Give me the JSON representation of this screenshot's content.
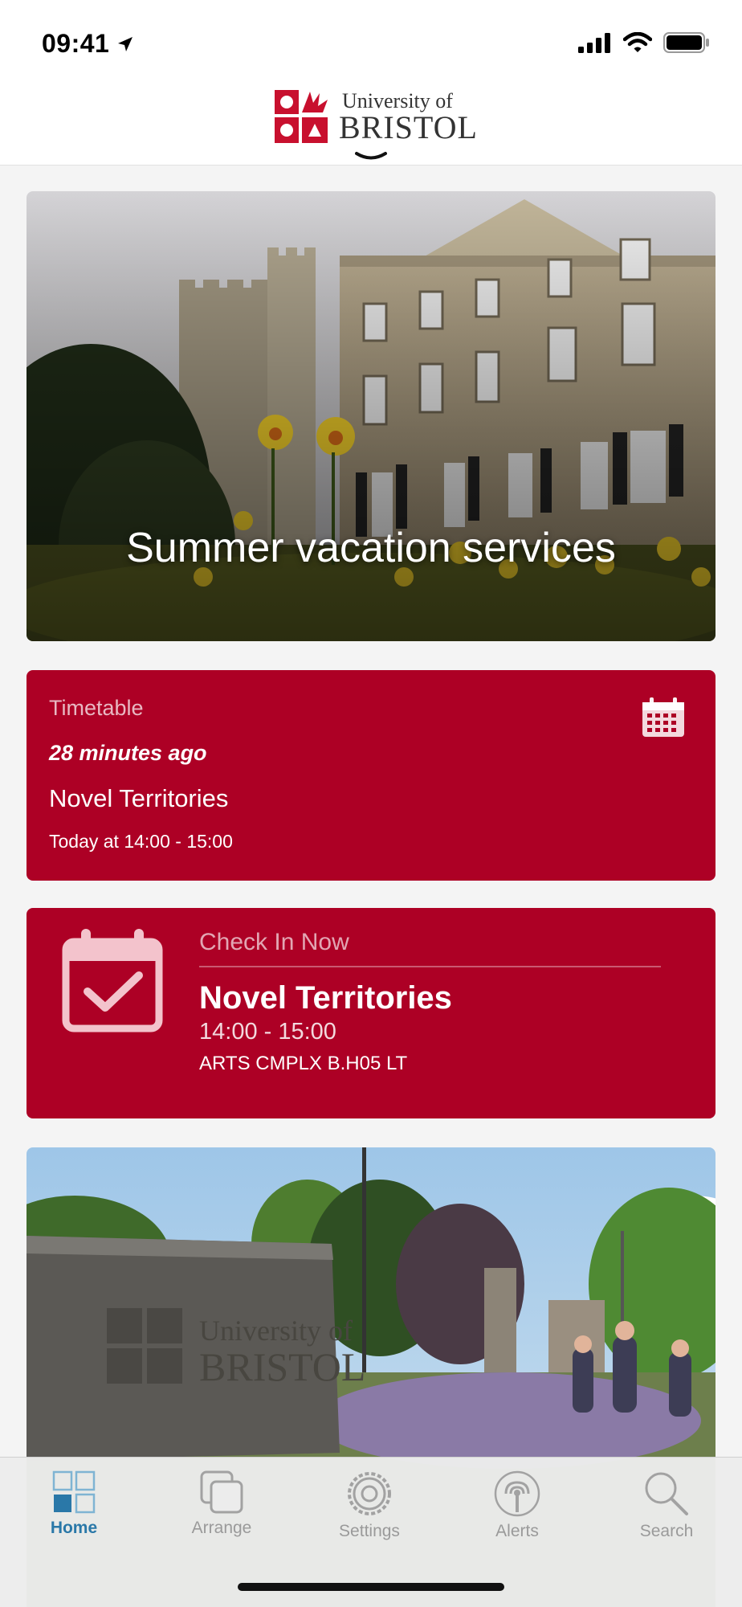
{
  "status_bar": {
    "time": "09:41",
    "icons": [
      "location-arrow-icon",
      "cellular-signal-icon",
      "wifi-icon",
      "battery-icon"
    ]
  },
  "header": {
    "logo_line1": "University of",
    "logo_line2": "BRISTOL",
    "expand_icon": "chevron-down-icon"
  },
  "hero_card": {
    "title": "Summer vacation services"
  },
  "timetable_card": {
    "label": "Timetable",
    "updated": "28 minutes ago",
    "event_title": "Novel Territories",
    "event_time": "Today at 14:00 - 15:00",
    "icon": "calendar-icon"
  },
  "checkin_card": {
    "label": "Check In Now",
    "event_title": "Novel Territories",
    "event_time": "14:00 - 15:00",
    "location": "ARTS CMPLX B.H05 LT",
    "icon": "calendar-check-icon"
  },
  "tab_bar": {
    "tabs": [
      {
        "label": "Home",
        "icon": "grid-icon",
        "active": true
      },
      {
        "label": "Arrange",
        "icon": "stack-icon",
        "active": false
      },
      {
        "label": "Settings",
        "icon": "gear-icon",
        "active": false
      },
      {
        "label": "Alerts",
        "icon": "broadcast-icon",
        "active": false
      },
      {
        "label": "Search",
        "icon": "search-icon",
        "active": false
      }
    ]
  },
  "colors": {
    "brand_red": "#ad0025",
    "active_tab": "#2a78a8",
    "inactive_tab": "#9a9a9a"
  }
}
